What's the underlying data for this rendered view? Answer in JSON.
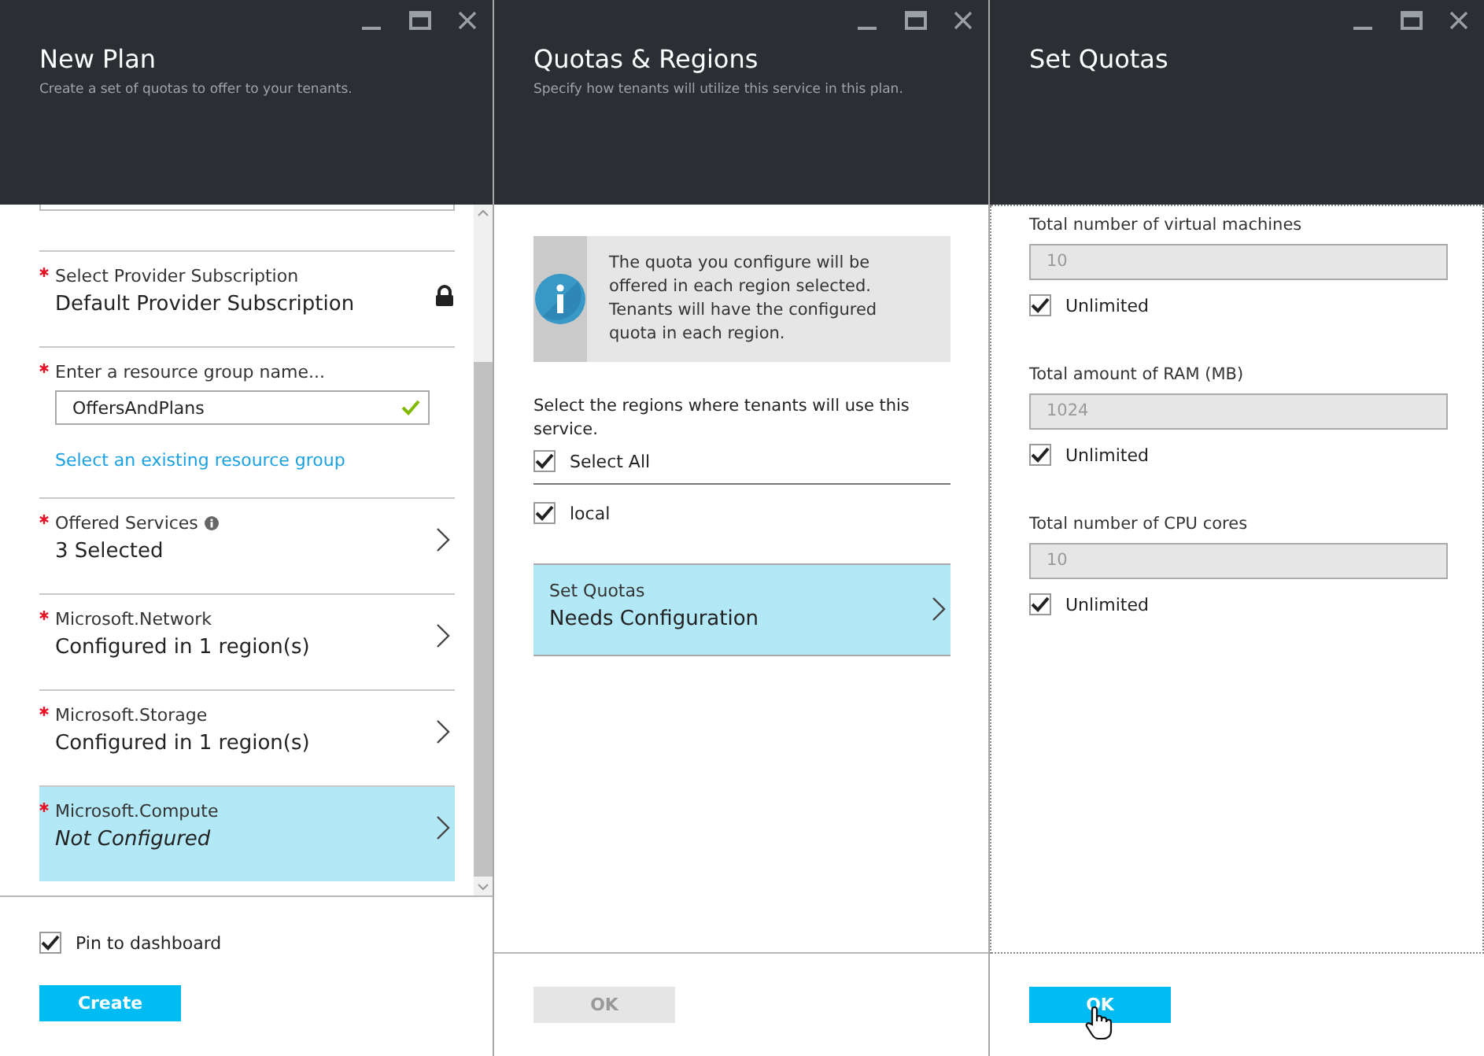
{
  "new_plan": {
    "title": "New Plan",
    "subtitle": "Create a set of quotas to offer to your tenants.",
    "fields": [
      {
        "kind": "locked",
        "required": true,
        "label": "Select Provider Subscription",
        "value": "Default Provider Subscription"
      },
      {
        "kind": "input",
        "required": true,
        "label": "Enter a resource group name...",
        "value": "OffersAndPlans",
        "valid": true,
        "link": "Select an existing resource group"
      },
      {
        "kind": "nav",
        "required": true,
        "label": "Offered Services",
        "info": true,
        "value": "3 Selected",
        "configured": true,
        "selected": false
      },
      {
        "kind": "nav",
        "required": true,
        "label": "Microsoft.Network",
        "value": "Configured in 1 region(s)",
        "configured": true,
        "selected": false
      },
      {
        "kind": "nav",
        "required": true,
        "label": "Microsoft.Storage",
        "value": "Configured in 1 region(s)",
        "configured": true,
        "selected": false
      },
      {
        "kind": "nav",
        "required": true,
        "label": "Microsoft.Compute",
        "value": "Not Configured",
        "configured": false,
        "selected": true
      }
    ],
    "pin": {
      "label": "Pin to dashboard",
      "checked": true
    },
    "button": {
      "label": "Create",
      "disabled": false
    }
  },
  "quotas_regions": {
    "title": "Quotas & Regions",
    "subtitle": "Specify how tenants will utilize this service in this plan.",
    "info": "The quota you configure will be offered in each region selected. Tenants will have the configured quota in each region.",
    "prompt": "Select the regions where tenants will use this service.",
    "regions": [
      {
        "label": "Select All",
        "checked": true
      },
      {
        "label": "local",
        "checked": true
      }
    ],
    "nav": {
      "label": "Set Quotas",
      "value": "Needs Configuration",
      "selected": true
    },
    "button": {
      "label": "OK",
      "disabled": true
    }
  },
  "set_quotas": {
    "title": "Set Quotas",
    "quotas": [
      {
        "label": "Total number of virtual machines",
        "value": "10",
        "unlimited_label": "Unlimited",
        "unlimited": true
      },
      {
        "label": "Total amount of RAM (MB)",
        "value": "1024",
        "unlimited_label": "Unlimited",
        "unlimited": true
      },
      {
        "label": "Total number of CPU cores",
        "value": "10",
        "unlimited_label": "Unlimited",
        "unlimited": true
      }
    ],
    "button": {
      "label": "OK",
      "disabled": false
    }
  }
}
